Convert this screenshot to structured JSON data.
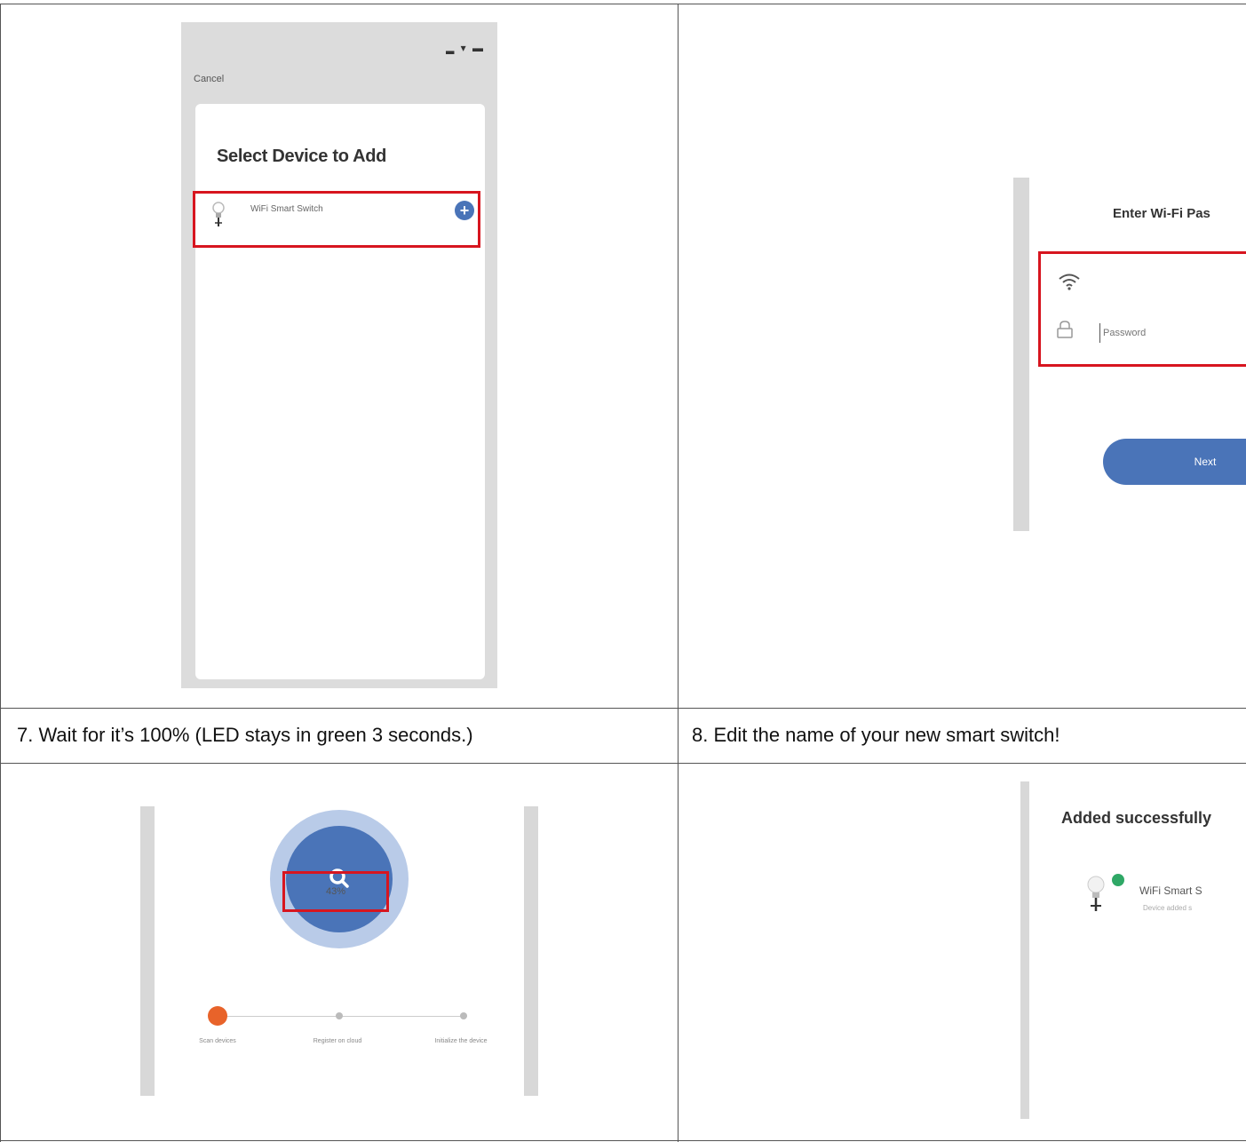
{
  "row1": {
    "select_device": {
      "status_icons": "▂ ▾ ▬",
      "cancel": "Cancel",
      "title": "Select Device to Add",
      "device_item": "WiFi Smart Switch"
    },
    "wifi": {
      "title": "Enter Wi-Fi Pas",
      "password_placeholder": "Password",
      "next_label": "Next"
    }
  },
  "captions": {
    "step7": "7. Wait for it’s 100% (LED stays in green 3 seconds.)",
    "step8": "8. Edit the name of your new smart switch!"
  },
  "row3": {
    "progress": {
      "percent_label": "43%",
      "percent_value": 43,
      "steps": [
        "Scan devices",
        "Register on cloud",
        "Initialize the device"
      ]
    },
    "added": {
      "title": "Added successfully",
      "device_name": "WiFi Smart S",
      "device_status": "Device added s"
    }
  },
  "colors": {
    "highlight": "#d7151f",
    "accent_blue": "#4a74b8",
    "step_active": "#e8632a",
    "success_green": "#2fa866"
  }
}
